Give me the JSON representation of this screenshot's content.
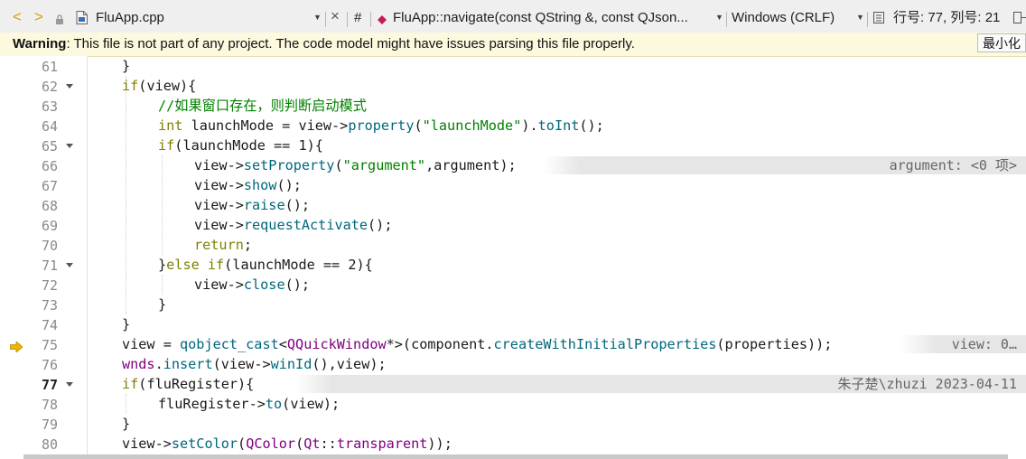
{
  "toolbar": {
    "back": "<",
    "forward": ">",
    "filename": "FluApp.cpp",
    "close": "×",
    "hash": "#",
    "symbol": "FluApp::navigate(const QString &, const QJson...",
    "line_ending": "Windows (CRLF)",
    "position": "行号: 77, 列号: 21"
  },
  "warning": {
    "label": "Warning",
    "message": ": This file is not part of any project. The code model might have issues parsing this file properly.",
    "button": "最小化"
  },
  "editor": {
    "current_line": 77,
    "line_numbers": [
      "61",
      "62",
      "63",
      "64",
      "65",
      "66",
      "67",
      "68",
      "69",
      "70",
      "71",
      "72",
      "73",
      "74",
      "75",
      "76",
      "77",
      "78",
      "79",
      "80"
    ],
    "annotations": {
      "line66": "argument: <0 项>",
      "line75": "view: 0…",
      "line77": "朱子楚\\zhuzi 2023-04-11"
    },
    "code": {
      "l61_close": "}",
      "l62_if": "if",
      "l62_rest": "(view){",
      "l63_comment": "//如果窗口存在，则判断启动模式",
      "l64_int": "int",
      "l64_a": " launchMode = view->",
      "l64_fn1": "property",
      "l64_b": "(",
      "l64_str": "\"launchMode\"",
      "l64_c": ").",
      "l64_fn2": "toInt",
      "l64_d": "();",
      "l65_if": "if",
      "l65_rest": "(launchMode == 1){",
      "l66_a": "view->",
      "l66_fn": "setProperty",
      "l66_b": "(",
      "l66_str": "\"argument\"",
      "l66_c": ",argument);",
      "l67_a": "view->",
      "l67_fn": "show",
      "l67_b": "();",
      "l68_a": "view->",
      "l68_fn": "raise",
      "l68_b": "();",
      "l69_a": "view->",
      "l69_fn": "requestActivate",
      "l69_b": "();",
      "l70_return": "return",
      "l70_b": ";",
      "l71_a": "}",
      "l71_else": "else if",
      "l71_b": "(launchMode == 2){",
      "l72_a": "view->",
      "l72_fn": "close",
      "l72_b": "();",
      "l73_close": "}",
      "l74_close": "}",
      "l75_a": "view = ",
      "l75_fn1": "qobject_cast",
      "l75_b": "<",
      "l75_ty": "QQuickWindow",
      "l75_c": "*>(",
      "l75_d": "component.",
      "l75_fn2": "createWithInitialProperties",
      "l75_e": "(properties));",
      "l76_ty": "wnds",
      "l76_a": ".",
      "l76_fn1": "insert",
      "l76_b": "(view->",
      "l76_fn2": "winId",
      "l76_c": "(),view);",
      "l77_if": "if",
      "l77_rest": "(fluRegister){",
      "l78_a": "fluRegister->",
      "l78_fn": "to",
      "l78_b": "(view);",
      "l79_close": "}",
      "l80_a": "view->",
      "l80_fn": "setColor",
      "l80_b": "(",
      "l80_ty": "QColor",
      "l80_c": "(",
      "l80_ty2": "Qt",
      "l80_d": "::",
      "l80_e": "transparent",
      "l80_f": "));"
    }
  },
  "icons": {
    "back": "chevron-left-icon",
    "forward": "chevron-right-icon",
    "lock": "lock-icon",
    "file": "cpp-file-icon",
    "symbol": "method-diamond-icon",
    "execution": "execution-arrow-icon"
  },
  "colors": {
    "keyword": "#808000",
    "function": "#00677c",
    "string": "#008000",
    "comment": "#008000",
    "type": "#800080",
    "warning_bg": "#fdf9de",
    "nav_arrow": "#d4a000",
    "symbol_diamond": "#c8185a"
  }
}
